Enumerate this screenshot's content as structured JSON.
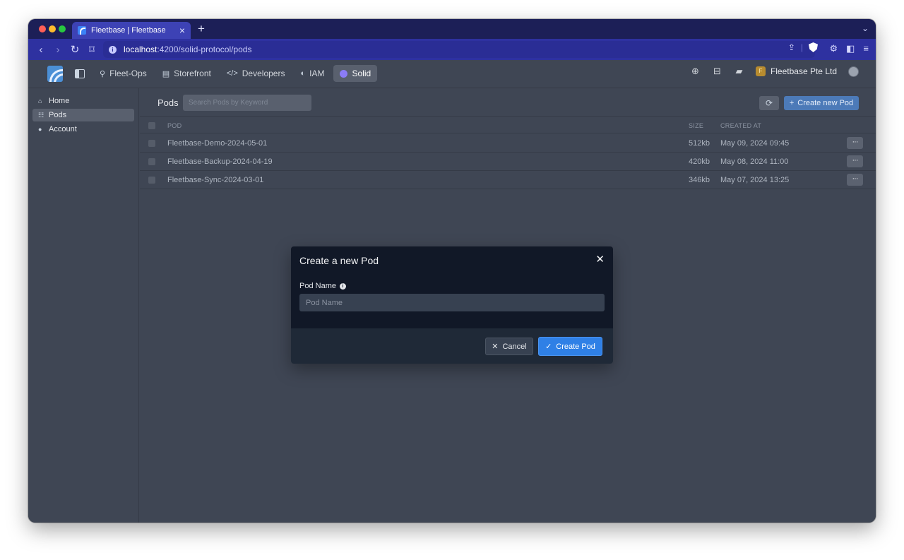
{
  "browser": {
    "tab_title": "Fleetbase | Fleetbase",
    "tab_close": "×",
    "new_tab": "+",
    "tab_menu": "⌄",
    "url_host": "localhost",
    "url_path": ":4200/solid-protocol/pods"
  },
  "header": {
    "nav": [
      {
        "label": "Fleet-Ops",
        "icon": "route-icon"
      },
      {
        "label": "Storefront",
        "icon": "store-icon"
      },
      {
        "label": "Developers",
        "icon": "code-icon"
      },
      {
        "label": "IAM",
        "icon": "shield-icon"
      },
      {
        "label": "Solid",
        "icon": "solid-icon",
        "active": true
      }
    ],
    "org_name": "Fleetbase Pte Ltd",
    "org_initial": "F"
  },
  "sidebar": {
    "items": [
      {
        "label": "Home",
        "icon": "home-icon"
      },
      {
        "label": "Pods",
        "icon": "list-icon",
        "active": true
      },
      {
        "label": "Account",
        "icon": "user-icon"
      }
    ]
  },
  "main": {
    "title": "Pods",
    "search_placeholder": "Search Pods by Keyword",
    "create_label": "Create new Pod",
    "columns": {
      "pod": "POD",
      "size": "SIZE",
      "created": "CREATED AT"
    },
    "rows": [
      {
        "name": "Fleetbase-Demo-2024-05-01",
        "size": "512kb",
        "created": "May 09, 2024 09:45"
      },
      {
        "name": "Fleetbase-Backup-2024-04-19",
        "size": "420kb",
        "created": "May 08, 2024 11:00"
      },
      {
        "name": "Fleetbase-Sync-2024-03-01",
        "size": "346kb",
        "created": "May 07, 2024 13:25"
      }
    ]
  },
  "modal": {
    "title": "Create a new Pod",
    "field_label": "Pod Name",
    "input_placeholder": "Pod Name",
    "input_value": "",
    "cancel_label": "Cancel",
    "confirm_label": "Create Pod"
  },
  "colors": {
    "tab_bar": "#1c1f57",
    "url_bar": "#2e31a0",
    "app_bg": "#3f4654",
    "modal_bg": "#111827",
    "primary": "#2f80e6"
  }
}
